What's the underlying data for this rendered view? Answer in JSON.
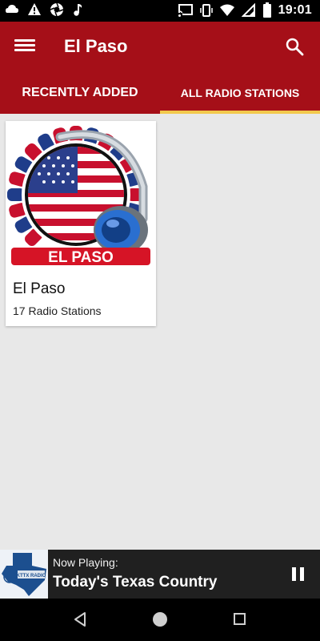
{
  "status": {
    "time": "19:01"
  },
  "appbar": {
    "title": "El Paso"
  },
  "tabs": [
    {
      "label": "RECENTLY ADDED",
      "active": false
    },
    {
      "label": "ALL RADIO STATIONS",
      "active": true
    }
  ],
  "cards": [
    {
      "badge": "EL PASO",
      "name": "El Paso",
      "count": "17 Radio Stations"
    }
  ],
  "player": {
    "label": "Now Playing:",
    "track": "Today's Texas Country",
    "thumb_text": "KTTX RADIO"
  },
  "colors": {
    "brand": "#a50f18",
    "tab_indicator": "#f2c94c",
    "background": "#e8e8e8"
  }
}
